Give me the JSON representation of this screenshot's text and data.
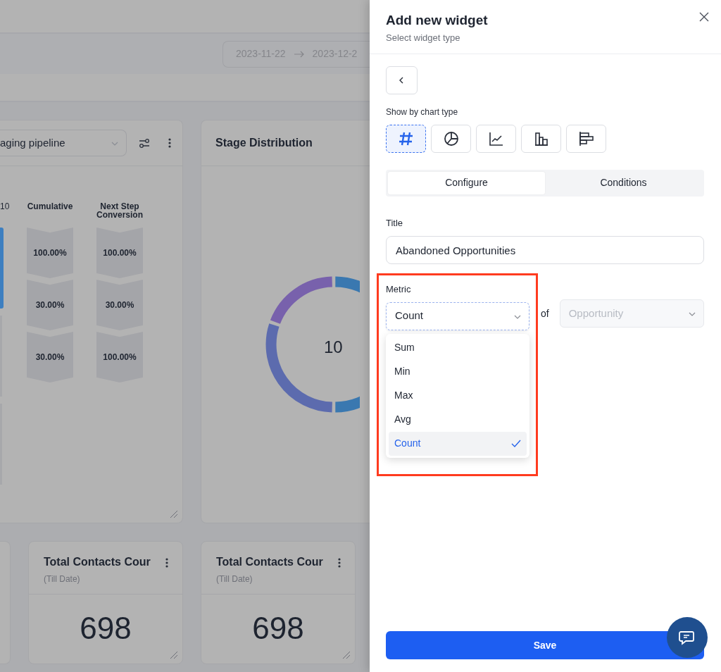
{
  "dashboard": {
    "date_range": {
      "start": "2023-11-22",
      "end": "2023-12-2"
    },
    "funnel_card": {
      "pipeline": "aging pipeline",
      "columns": [
        "10",
        "Cumulative",
        "Next Step Conversion"
      ],
      "cumulative": [
        "100.00%",
        "30.00%",
        "30.00%"
      ],
      "next_step": [
        "100.00%",
        "30.00%",
        "100.00%"
      ]
    },
    "distribution_card": {
      "title": "Stage Distribution",
      "total": "10"
    },
    "stat_cards": [
      {
        "title": "Total Contacts Cour",
        "subtitle": "(Till Date)",
        "value": "698"
      },
      {
        "title": "Total Contacts Cour",
        "subtitle": "(Till Date)",
        "value": "698"
      }
    ]
  },
  "drawer": {
    "title": "Add new widget",
    "subtitle": "Select widget type",
    "chart_type_label": "Show by chart type",
    "chart_types": [
      {
        "kind": "number",
        "selected": true
      },
      {
        "kind": "pie",
        "selected": false
      },
      {
        "kind": "line",
        "selected": false
      },
      {
        "kind": "bar",
        "selected": false
      },
      {
        "kind": "horizontal-bar",
        "selected": false
      }
    ],
    "tabs": [
      {
        "label": "Configure",
        "selected": true
      },
      {
        "label": "Conditions",
        "selected": false
      }
    ],
    "title_field": {
      "label": "Title",
      "value": "Abandoned Opportunities"
    },
    "metric": {
      "label": "Metric",
      "value": "Count",
      "expanded": true,
      "options": [
        {
          "label": "Sum",
          "selected": false
        },
        {
          "label": "Min",
          "selected": false
        },
        {
          "label": "Max",
          "selected": false
        },
        {
          "label": "Avg",
          "selected": false
        },
        {
          "label": "Count",
          "selected": true
        }
      ]
    },
    "of_label": "of",
    "object_field": {
      "placeholder": "Opportunity",
      "disabled": true
    },
    "save_label": "Save"
  }
}
